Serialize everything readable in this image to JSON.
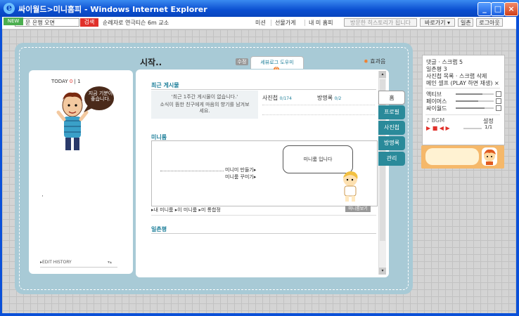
{
  "window": {
    "title": "싸이월드>미니홈피 - Windows Internet Explorer",
    "ie_icon": "e"
  },
  "toolbar": {
    "badge": "NEW",
    "input_value": "문 은행 오면",
    "search_label": "검색",
    "promo_text": "순례자로 연극티슨 6m 교소",
    "links": [
      "미션",
      "선물가게",
      "내 미 홈피",
      "방문한 히스토리가 됩니다",
      "바로가기 ▾",
      "일촌",
      "로그아웃"
    ]
  },
  "left": {
    "today_label": "TODAY",
    "today_count": "0",
    "total_count": "1",
    "speech": "지금 기분이 좋습니다.",
    "dot": "·",
    "edit_history": "▸EDIT HISTORY",
    "edit_arrows": "▾▴"
  },
  "header": {
    "title": "시작..",
    "edit_btn": "수정",
    "notice_tab": "세뷰로그 도우미",
    "badge_num": "0",
    "effect": "효과음"
  },
  "recent": {
    "title": "최근 게시물",
    "msg1": "'최근 1주간 게시물이 없습니다.'",
    "msg2": "소식이 뜸한 친구에게 마음의 향기를 남겨보세요.",
    "counter1_label": "사진첩",
    "counter1_value": "0/174",
    "counter2_label": "방명록",
    "counter2_value": "0/2"
  },
  "miniroom": {
    "title": "미니룸",
    "bubble": "미니룸 입니다",
    "link1": "미니미 만들기▸",
    "link2": "미니룸 꾸미기▸",
    "footer_links": [
      "▸내 미니룸",
      "▸이 미니룸",
      "▸미 통합정"
    ],
    "footer_btn": "미니룸보기"
  },
  "ilchon": {
    "title": "일촌평"
  },
  "tabs": [
    "홈",
    "프로필",
    "사진첩",
    "방명록",
    "관리"
  ],
  "side": {
    "rows": [
      "댓글 · 스크랩 5",
      "일촌평 3",
      "사진첩 목록 · 스크랩 삭제",
      "메인 셀프 (PLAY 하면 재생) ×"
    ],
    "sliders": [
      {
        "label": "액티브",
        "value": 0.7
      },
      {
        "label": "페이머스",
        "value": 0.6
      },
      {
        "label": "싸이월드",
        "value": 0.75
      }
    ],
    "player_track": "♪ BGM",
    "player_setting": "설정",
    "player_controls": "▶ ■ ◀ ▶",
    "player_status": "1/1"
  },
  "colors": {
    "title_blue": "#0a4ed0",
    "book_blue": "#a8cad6",
    "tab_teal": "#2a8a9a",
    "section_teal": "#1e7f9a",
    "search_red": "#e0302a",
    "banner_orange": "#f5b86a"
  }
}
